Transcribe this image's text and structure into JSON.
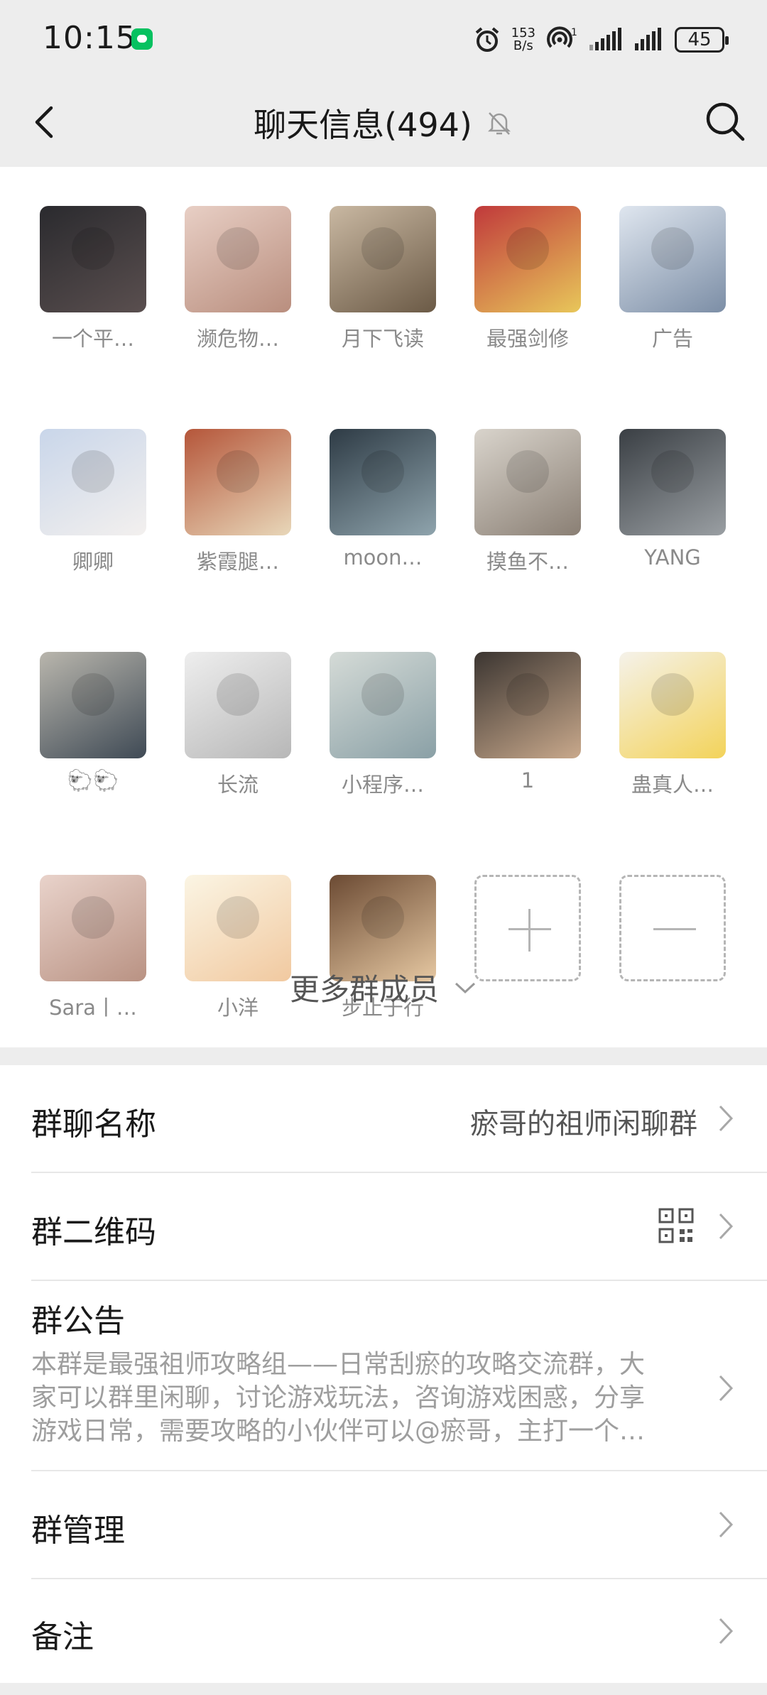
{
  "status_bar": {
    "time": "10:15",
    "speed_value": "153",
    "speed_unit": "B/s",
    "hotspot_count": "1",
    "battery": "45"
  },
  "nav": {
    "title": "聊天信息(494)"
  },
  "members": [
    {
      "name": "一个平…",
      "c1": "#2a2a2e",
      "c2": "#5a4f4f"
    },
    {
      "name": "濒危物…",
      "c1": "#e8cfc5",
      "c2": "#b98e7e"
    },
    {
      "name": "月下飞读",
      "c1": "#c9b8a2",
      "c2": "#6b5a46"
    },
    {
      "name": "最强剑修",
      "c1": "#c0393b",
      "c2": "#e8c75a"
    },
    {
      "name": "广告",
      "c1": "#dfe6ef",
      "c2": "#7c8ea6"
    },
    {
      "name": "卿卿",
      "c1": "#c9d6ea",
      "c2": "#f3f0ee"
    },
    {
      "name": "紫霞腿…",
      "c1": "#b5563a",
      "c2": "#e8d7b9"
    },
    {
      "name": "moon…",
      "c1": "#2e3b45",
      "c2": "#8fa4ad"
    },
    {
      "name": "摸鱼不…",
      "c1": "#d9d4cc",
      "c2": "#8a7f74"
    },
    {
      "name": "YANG",
      "c1": "#3a3f44",
      "c2": "#9a9fa3"
    },
    {
      "name": "🐑🐑",
      "c1": "#b9b6ad",
      "c2": "#3f4a55"
    },
    {
      "name": "长流",
      "c1": "#eeeeee",
      "c2": "#b7b7b7"
    },
    {
      "name": "小程序…",
      "c1": "#d5dbd7",
      "c2": "#8aa0a6"
    },
    {
      "name": "1",
      "c1": "#3b3531",
      "c2": "#c9a98c"
    },
    {
      "name": "蛊真人…",
      "c1": "#f5f2ea",
      "c2": "#f3d35a"
    },
    {
      "name": "Sara丨…",
      "c1": "#e9d3cb",
      "c2": "#b99283"
    },
    {
      "name": "小洋",
      "c1": "#fbf5e4",
      "c2": "#f1c9a0"
    },
    {
      "name": "步止于行",
      "c1": "#6b4a33",
      "c2": "#e6c8a2"
    }
  ],
  "more_members": "更多群成员",
  "settings": {
    "group_name_label": "群聊名称",
    "group_name_value": "瘀哥的祖师闲聊群",
    "qr_label": "群二维码",
    "notice_label": "群公告",
    "notice_line1": "本群是最强祖师攻略组——日常刮瘀的攻略交流群，大",
    "notice_line2": "家可以群里闲聊，讨论游戏玩法，咨询游戏困惑，分享",
    "notice_line3": "游戏日常，需要攻略的小伙伴可以@瘀哥，主打一个…",
    "manage_label": "群管理",
    "remark_label": "备注"
  }
}
